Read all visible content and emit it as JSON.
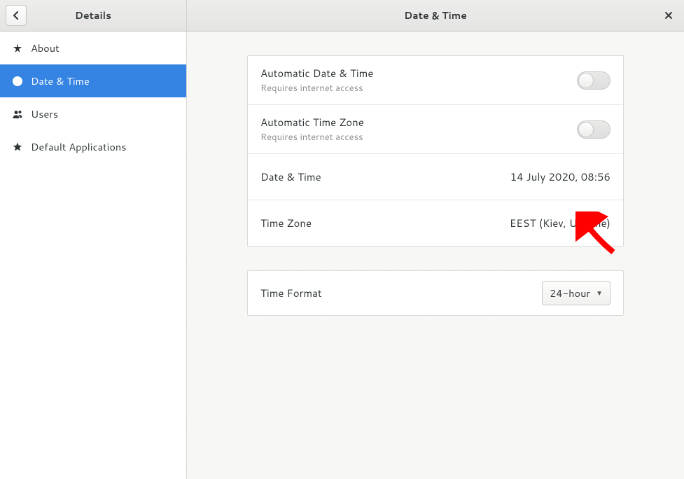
{
  "header": {
    "left_title": "Details",
    "right_title": "Date & Time"
  },
  "sidebar": {
    "items": [
      {
        "label": "About"
      },
      {
        "label": "Date & Time"
      },
      {
        "label": "Users"
      },
      {
        "label": "Default Applications"
      }
    ],
    "selected_index": 1
  },
  "main": {
    "automatic_datetime": {
      "label": "Automatic Date & Time",
      "sub": "Requires internet access",
      "on": false
    },
    "automatic_timezone": {
      "label": "Automatic Time Zone",
      "sub": "Requires internet access",
      "on": false
    },
    "datetime": {
      "label": "Date & Time",
      "value": "14 July 2020, 08:56"
    },
    "timezone": {
      "label": "Time Zone",
      "value": "EEST (Kiev, Ukraine)"
    },
    "time_format": {
      "label": "Time Format",
      "value": "24-hour"
    }
  }
}
